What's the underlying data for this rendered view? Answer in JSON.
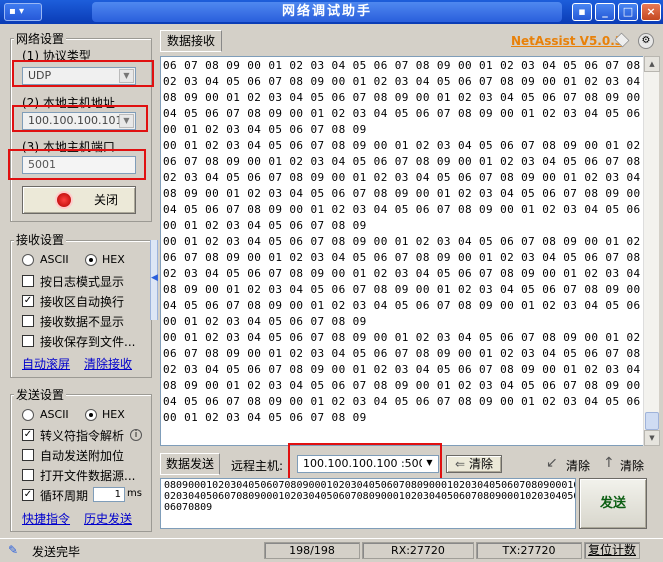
{
  "window": {
    "title": "网络调试助手",
    "sys_label": "▪ ▾",
    "pin": "▪",
    "minimize": "_",
    "maximize": "□",
    "close": "×"
  },
  "brand": {
    "name": "NetAssist V5.0.3"
  },
  "net": {
    "group": "网络设置",
    "protocol_label": "(1) 协议类型",
    "protocol_value": "UDP",
    "host_label": "(2) 本地主机地址",
    "host_value": "100.100.100.101",
    "port_label": "(3) 本地主机端口",
    "port_value": "5001",
    "close_btn": "关闭"
  },
  "recv": {
    "group": "接收设置",
    "ascii": "ASCII",
    "hex": "HEX",
    "opt_log": "按日志模式显示",
    "opt_wrap": "接收区自动换行",
    "opt_hide": "接收数据不显示",
    "opt_save": "接收保存到文件...",
    "link_scroll": "自动滚屏",
    "link_clear": "清除接收"
  },
  "send": {
    "group": "发送设置",
    "ascii": "ASCII",
    "hex": "HEX",
    "opt_escape": "转义符指令解析",
    "opt_append": "自动发送附加位",
    "opt_file": "打开文件数据源...",
    "opt_cycle": "循环周期",
    "cycle_value": "1",
    "cycle_unit": "ms",
    "link_shortcut": "快捷指令",
    "link_history": "历史发送"
  },
  "tabs": {
    "receive": "数据接收",
    "send": "数据发送"
  },
  "remote": {
    "label": "远程主机:",
    "value": "100.100.100.100 :5000",
    "clear_btn": "清除",
    "clear2": "清除",
    "clear3": "清除",
    "send_btn": "发送"
  },
  "rx_lines": [
    "06 07 08 09 00 01 02 03 04 05 06 07 08 09 00 01 02 03 04 05 06 07 08 09 00 01",
    "02 03 04 05 06 07 08 09 00 01 02 03 04 05 06 07 08 09 00 01 02 03 04 05 06 07",
    "08 09 00 01 02 03 04 05 06 07 08 09 00 01 02 03 04 05 06 07 08 09 00 01 02 03",
    "04 05 06 07 08 09 00 01 02 03 04 05 06 07 08 09 00 01 02 03 04 05 06 07 08 09",
    "00 01 02 03 04 05 06 07 08 09",
    "00 01 02 03 04 05 06 07 08 09 00 01 02 03 04 05 06 07 08 09 00 01 02 03 04 05",
    "06 07 08 09 00 01 02 03 04 05 06 07 08 09 00 01 02 03 04 05 06 07 08 09 00 01",
    "02 03 04 05 06 07 08 09 00 01 02 03 04 05 06 07 08 09 00 01 02 03 04 05 06 07",
    "08 09 00 01 02 03 04 05 06 07 08 09 00 01 02 03 04 05 06 07 08 09 00 01 02 03",
    "04 05 06 07 08 09 00 01 02 03 04 05 06 07 08 09 00 01 02 03 04 05 06 07 08 09",
    "00 01 02 03 04 05 06 07 08 09",
    "00 01 02 03 04 05 06 07 08 09 00 01 02 03 04 05 06 07 08 09 00 01 02 03 04 05",
    "06 07 08 09 00 01 02 03 04 05 06 07 08 09 00 01 02 03 04 05 06 07 08 09 00 01",
    "02 03 04 05 06 07 08 09 00 01 02 03 04 05 06 07 08 09 00 01 02 03 04 05 06 07",
    "08 09 00 01 02 03 04 05 06 07 08 09 00 01 02 03 04 05 06 07 08 09 00 01 02 03",
    "04 05 06 07 08 09 00 01 02 03 04 05 06 07 08 09 00 01 02 03 04 05 06 07 08 09",
    "00 01 02 03 04 05 06 07 08 09",
    "00 01 02 03 04 05 06 07 08 09 00 01 02 03 04 05 06 07 08 09 00 01 02 03 04 05",
    "06 07 08 09 00 01 02 03 04 05 06 07 08 09 00 01 02 03 04 05 06 07 08 09 00 01",
    "02 03 04 05 06 07 08 09 00 01 02 03 04 05 06 07 08 09 00 01 02 03 04 05 06 07",
    "08 09 00 01 02 03 04 05 06 07 08 09 00 01 02 03 04 05 06 07 08 09 00 01 02 03",
    "04 05 06 07 08 09 00 01 02 03 04 05 06 07 08 09 00 01 02 03 04 05 06 07 08 09",
    "00 01 02 03 04 05 06 07 08 09"
  ],
  "tx_lines": [
    "0809000102030405060708090001020304050607080900010203040506070809000102030405060708090001",
    "0203040506070809000102030405060708090001020304050607080900010203040506070809000102030405",
    "06070809"
  ],
  "status": {
    "text": "发送完毕",
    "count": "198/198",
    "rx": "RX:27720",
    "tx": "TX:27720",
    "reset": "复位计数"
  }
}
